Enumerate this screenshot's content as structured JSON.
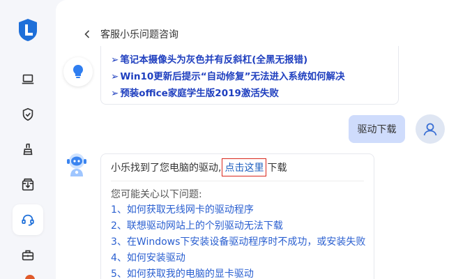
{
  "header": {
    "back_icon": "chevron-left-icon",
    "title": "客服小乐问题咨询"
  },
  "sidebar": {
    "items": [
      {
        "icon": "laptop-icon",
        "active": false
      },
      {
        "icon": "shield-check-icon",
        "active": false
      },
      {
        "icon": "broom-icon",
        "active": false
      },
      {
        "icon": "download-box-icon",
        "active": false
      },
      {
        "icon": "headset-icon",
        "active": true
      },
      {
        "icon": "toolbox-icon",
        "active": false
      }
    ]
  },
  "messages": {
    "bot_links": [
      "笔记本摄像头为灰色并有反斜杠(全黑无报错)",
      "Win10更新后提示“自动修复”无法进入系统如何解决",
      "预装office家庭学生版2019激活失败"
    ],
    "link_marker": "➢",
    "user_message": "驱动下载",
    "reply": {
      "before": "小乐找到了您电脑的驱动,",
      "link": "点击这里",
      "after": "下载",
      "subtitle": "您可能关心以下问题:",
      "questions": [
        "1、如何获取无线网卡的驱动程序",
        "2、联想驱动网站上的个别驱动无法下载",
        "3、在Windows下安装设备驱动程序时不成功，或安装失败",
        "4、如何安装驱动",
        "5、如何获取我的电脑的显卡驱动"
      ]
    }
  },
  "colors": {
    "accent": "#1f5fbf",
    "link_bold": "#1f3fbf",
    "highlight_box": "#d9261c",
    "user_bubble": "#cfdcfc"
  }
}
